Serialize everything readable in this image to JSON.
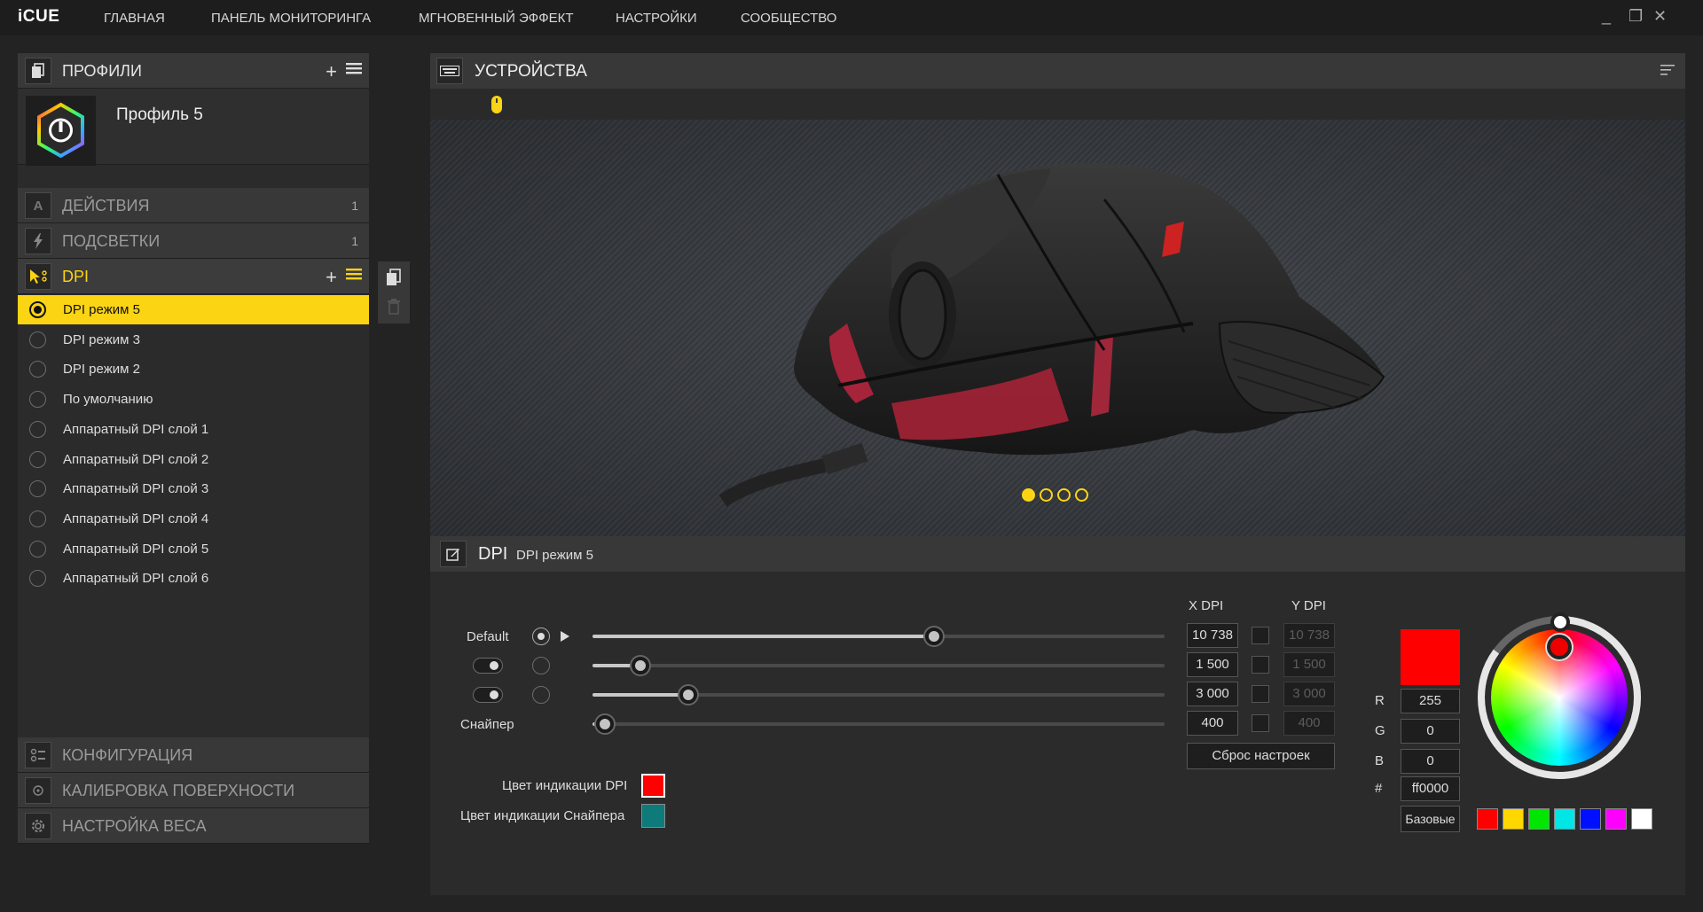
{
  "app": {
    "logo": "iCUE"
  },
  "nav": [
    "ГЛАВНАЯ",
    "ПАНЕЛЬ МОНИТОРИНГА",
    "МГНОВЕННЫЙ ЭФФЕКТ",
    "НАСТРОЙКИ",
    "СООБЩЕСТВО"
  ],
  "window_controls": {
    "minimize": "_",
    "maximize": "❐",
    "close": "✕"
  },
  "profiles": {
    "header": "ПРОФИЛИ",
    "current_profile": "Профиль 5"
  },
  "sections": {
    "actions": {
      "label": "ДЕЙСТВИЯ",
      "count": "1"
    },
    "lighting": {
      "label": "ПОДСВЕТКИ",
      "count": "1"
    },
    "dpi": {
      "label": "DPI"
    },
    "config": {
      "label": "КОНФИГУРАЦИЯ"
    },
    "calibration": {
      "label": "КАЛИБРОВКА ПОВЕРХНОСТИ"
    },
    "weight": {
      "label": "НАСТРОЙКА ВЕСА"
    }
  },
  "dpi_list": [
    {
      "label": "DPI режим 5",
      "selected": true
    },
    {
      "label": "DPI режим 3",
      "selected": false
    },
    {
      "label": "DPI режим 2",
      "selected": false
    },
    {
      "label": "По умолчанию",
      "selected": false
    },
    {
      "label": "Аппаратный DPI слой 1",
      "selected": false
    },
    {
      "label": "Аппаратный DPI слой 2",
      "selected": false
    },
    {
      "label": "Аппаратный DPI слой 3",
      "selected": false
    },
    {
      "label": "Аппаратный DPI слой 4",
      "selected": false
    },
    {
      "label": "Аппаратный DPI слой 5",
      "selected": false
    },
    {
      "label": "Аппаратный DPI слой 6",
      "selected": false
    }
  ],
  "devices": {
    "header": "УСТРОЙСТВА",
    "carousel_pages": 4,
    "carousel_active": 1
  },
  "dpi_editor": {
    "title": "DPI",
    "subtitle": "DPI режим 5",
    "col_x": "X DPI",
    "col_y": "Y DPI",
    "stages": [
      {
        "label": "Default",
        "x": "10 738",
        "y": "10 738",
        "value": 10738
      },
      {
        "label": "",
        "x": "1 500",
        "y": "1 500",
        "value": 1500
      },
      {
        "label": "",
        "x": "3 000",
        "y": "3 000",
        "value": 3000
      },
      {
        "label": "Снайпер",
        "x": "400",
        "y": "400",
        "value": 400
      }
    ],
    "slider_max": 18000,
    "reset_label": "Сброс настроек",
    "dpi_color_label": "Цвет индикации DPI",
    "sniper_color_label": "Цвет индикации Снайпера",
    "dpi_color": "#ff0000",
    "sniper_color": "#0f7a7a"
  },
  "color_picker": {
    "r_label": "R",
    "r": "255",
    "g_label": "G",
    "g": "0",
    "b_label": "B",
    "b": "0",
    "hex_label": "#",
    "hex": "ff0000",
    "presets_label": "Базовые",
    "presets": [
      "#ff0000",
      "#ffd700",
      "#00e600",
      "#00e5e5",
      "#0010ff",
      "#ff00ff",
      "#ffffff"
    ]
  }
}
